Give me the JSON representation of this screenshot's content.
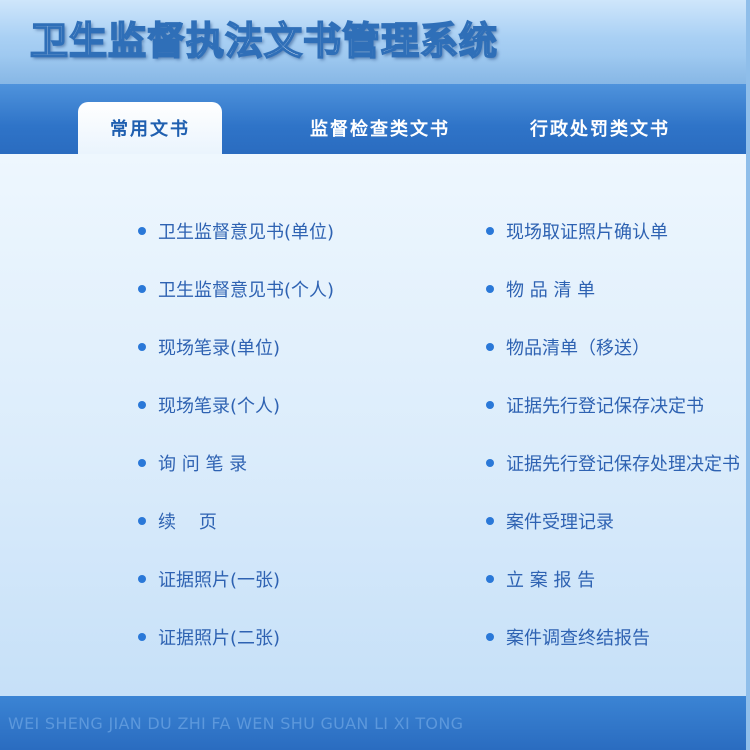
{
  "header": {
    "title": "卫生监督执法文书管理系统"
  },
  "tabs": [
    {
      "label": "常用文书",
      "active": true
    },
    {
      "label": "监督检查类文书",
      "active": false
    },
    {
      "label": "行政处罚类文书",
      "active": false
    }
  ],
  "left_items": [
    "卫生监督意见书(单位)",
    "卫生监督意见书(个人)",
    "现场笔录(单位)",
    "现场笔录(个人)",
    "询 问 笔 录",
    "续    页",
    "证据照片(一张)",
    "证据照片(二张)"
  ],
  "right_items": [
    "现场取证照片确认单",
    "物 品 清 单",
    "物品清单（移送）",
    "证据先行登记保存决定书",
    "证据先行登记保存处理决定书",
    "案件受理记录",
    "立 案 报 告",
    "案件调查终结报告"
  ],
  "footer": {
    "text": "WEI SHENG JIAN DU ZHI FA WEN SHU GUAN LI XI TONG"
  },
  "colors": {
    "header_bg": "#a9d0f4",
    "tabbar_bg": "#2f74c8",
    "link_text": "#2e62b2",
    "bullet": "#2a78d8",
    "footer_bg": "#2a6cc0"
  }
}
